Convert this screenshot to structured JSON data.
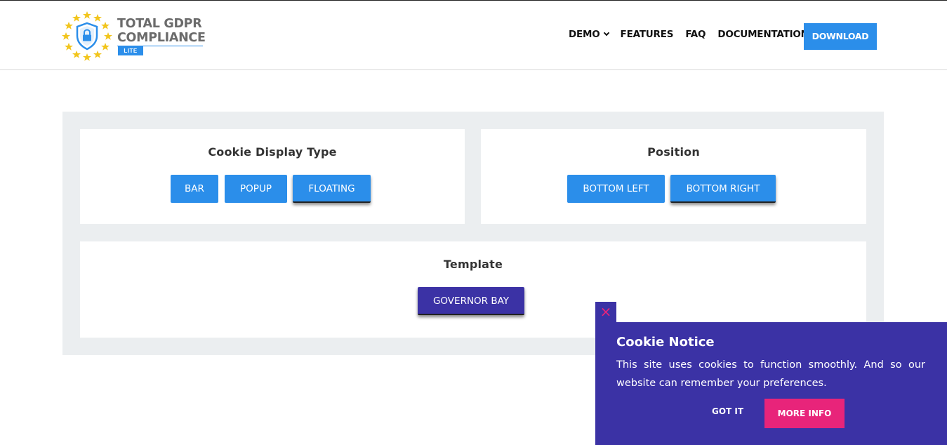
{
  "header": {
    "logo": {
      "line1": "TOTAL GDPR",
      "line2": "COMPLIANCE",
      "badge": "LITE",
      "colors": {
        "text": "#6b6b6b",
        "accent": "#2b8eea",
        "stars": "#f2c51c"
      }
    },
    "nav": {
      "demo": "DEMO",
      "features": "FEATURES",
      "faq": "FAQ",
      "documentation": "DOCUMENTATION",
      "download": "DOWNLOAD"
    }
  },
  "cards": {
    "display_type": {
      "title": "Cookie Display Type",
      "options": [
        "BAR",
        "POPUP",
        "FLOATING"
      ],
      "selected": "FLOATING"
    },
    "position": {
      "title": "Position",
      "options": [
        "BOTTOM LEFT",
        "BOTTOM RIGHT"
      ],
      "selected": "BOTTOM RIGHT"
    },
    "template": {
      "title": "Template",
      "options": [
        "GOVERNOR BAY"
      ],
      "selected": "GOVERNOR BAY"
    }
  },
  "cookie_notice": {
    "close_glyph": "×",
    "title": "Cookie Notice",
    "text": "This site uses cookies to function smoothly. And so our website can remember your preferences.",
    "got_it": "GOT IT",
    "more_info": "MORE INFO"
  },
  "colors": {
    "primary_blue": "#2b8eea",
    "purple": "#3b32a5",
    "pink": "#e8247a",
    "panel_bg": "#ebeef0"
  }
}
